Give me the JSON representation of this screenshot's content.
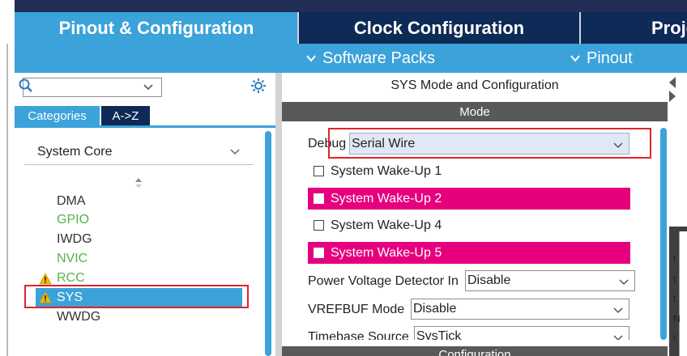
{
  "tabs": {
    "pinout": "Pinout & Configuration",
    "clock": "Clock Configuration",
    "project": "Proje"
  },
  "subbar": {
    "software_packs": "Software Packs",
    "pinout": "Pinout"
  },
  "search": {
    "value": ""
  },
  "category_tabs": {
    "categories": "Categories",
    "atoz": "A->Z"
  },
  "group": {
    "label": "System Core"
  },
  "items": [
    {
      "label": "DMA",
      "color": "default",
      "warning": false
    },
    {
      "label": "GPIO",
      "color": "green",
      "warning": false
    },
    {
      "label": "IWDG",
      "color": "default",
      "warning": false
    },
    {
      "label": "NVIC",
      "color": "green",
      "warning": false
    },
    {
      "label": "RCC",
      "color": "green",
      "warning": true
    },
    {
      "label": "SYS",
      "color": "white",
      "warning": true,
      "selected": true
    },
    {
      "label": "WWDG",
      "color": "default",
      "warning": false
    }
  ],
  "right": {
    "title": "SYS Mode and Configuration",
    "mode_header": "Mode",
    "debug_label": "Debug",
    "debug_value": "Serial Wire",
    "wakeups": [
      {
        "label": "System Wake-Up 1",
        "highlighted": false
      },
      {
        "label": "System Wake-Up 2",
        "highlighted": true
      },
      {
        "label": "System Wake-Up 4",
        "highlighted": false
      },
      {
        "label": "System Wake-Up 5",
        "highlighted": true
      }
    ],
    "pvd_label": "Power Voltage Detector In",
    "pvd_value": "Disable",
    "vrefbuf_label": "VREFBUF Mode",
    "vrefbuf_value": "Disable",
    "timebase_label": "Timebase Source",
    "timebase_value": "SysTick",
    "config_header": "Configuration"
  },
  "colors": {
    "accent_blue": "#3ca2da",
    "navy": "#0e2a56",
    "highlight_pink": "#e6007e",
    "annotation_red": "#e0232e",
    "gpio_green": "#55b34b"
  },
  "strip": {
    "letters": [
      "t",
      "t",
      "t",
      "N",
      "r"
    ]
  }
}
